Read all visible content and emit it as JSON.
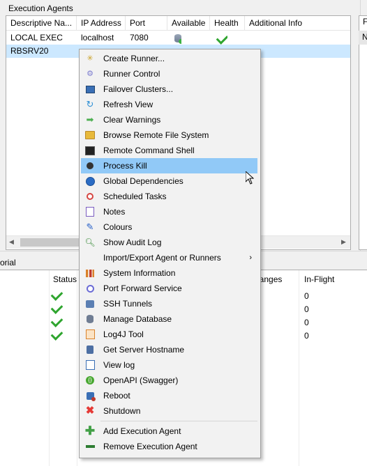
{
  "agents_panel": {
    "title": "Execution Agents",
    "columns": [
      "Descriptive Na...",
      "IP Address",
      "Port",
      "Available",
      "Health",
      "Additional Info"
    ],
    "rows": [
      {
        "name": "LOCAL EXEC",
        "ip": "localhost",
        "port": "7080",
        "available": "db-ok-icon",
        "health": "check-icon",
        "info": ""
      },
      {
        "name": "RBSRV20",
        "ip": "",
        "port": "",
        "available": "",
        "health": "",
        "info": ""
      }
    ]
  },
  "bottom_panel": {
    "title_fragment": "orial",
    "columns": [
      "Status",
      "hanges",
      "In-Flight"
    ],
    "rows": [
      {
        "status": "check-icon",
        "in_flight": "0"
      },
      {
        "status": "check-icon",
        "in_flight": "0"
      },
      {
        "status": "check-icon",
        "in_flight": "0"
      },
      {
        "status": "check-icon",
        "in_flight": "0"
      }
    ]
  },
  "right_panel": {
    "header_fragment": "F",
    "cell_fragment": "N"
  },
  "context_menu": {
    "items": [
      {
        "label": "Create Runner...",
        "icon": "new-runner-icon",
        "color": "#c9a227"
      },
      {
        "label": "Runner Control",
        "icon": "gear-icon",
        "color": "#7b7bcf"
      },
      {
        "label": "Failover Clusters...",
        "icon": "cluster-icon",
        "color": "#3a6fb5"
      },
      {
        "label": "Refresh View",
        "icon": "refresh-icon",
        "color": "#2d8fd5"
      },
      {
        "label": "Clear Warnings",
        "icon": "arrow-right-icon",
        "color": "#4caf50"
      },
      {
        "label": "Browse Remote File System",
        "icon": "folder-icon",
        "color": "#e8b93a"
      },
      {
        "label": "Remote Command Shell",
        "icon": "terminal-icon",
        "color": "#222222"
      },
      {
        "label": "Process Kill",
        "icon": "bomb-icon",
        "color": "#333333"
      },
      {
        "label": "Global Dependencies",
        "icon": "globe-icon",
        "color": "#2b6cc4"
      },
      {
        "label": "Scheduled Tasks",
        "icon": "alarm-clock-icon",
        "color": "#d64541"
      },
      {
        "label": "Notes",
        "icon": "notes-icon",
        "color": "#7a5cc0"
      },
      {
        "label": "Colours",
        "icon": "paint-brush-icon",
        "color": "#2a62c9"
      },
      {
        "label": "Show Audit Log",
        "icon": "magnifier-icon",
        "color": "#3c8d3c"
      },
      {
        "label": "Import/Export Agent or Runners",
        "icon": "",
        "color": "",
        "submenu": "›"
      },
      {
        "label": "System Information",
        "icon": "chart-icon",
        "color": "#d9822b"
      },
      {
        "label": "Port Forward Service",
        "icon": "clock-icon",
        "color": "#6b6bd6"
      },
      {
        "label": "SSH Tunnels",
        "icon": "tunnel-icon",
        "color": "#5b7fb3"
      },
      {
        "label": "Manage Database",
        "icon": "database-icon",
        "color": "#6f7d93"
      },
      {
        "label": "Log4J Tool",
        "icon": "log4j-icon",
        "color": "#d9822b"
      },
      {
        "label": "Get Server Hostname",
        "icon": "server-icon",
        "color": "#4d6fa3"
      },
      {
        "label": "View log",
        "icon": "view-log-icon",
        "color": "#3a6fb5"
      },
      {
        "label": "OpenAPI (Swagger)",
        "icon": "swagger-icon",
        "color": "#49a832"
      },
      {
        "label": "Reboot",
        "icon": "reboot-icon",
        "color": "#c0392b"
      },
      {
        "label": "Shutdown",
        "icon": "close-icon",
        "color": "#e53935"
      },
      {
        "label": "Add Execution Agent",
        "icon": "plus-icon",
        "color": "#43a047"
      },
      {
        "label": "Remove Execution Agent",
        "icon": "minus-icon",
        "color": "#2e7d32"
      }
    ]
  }
}
